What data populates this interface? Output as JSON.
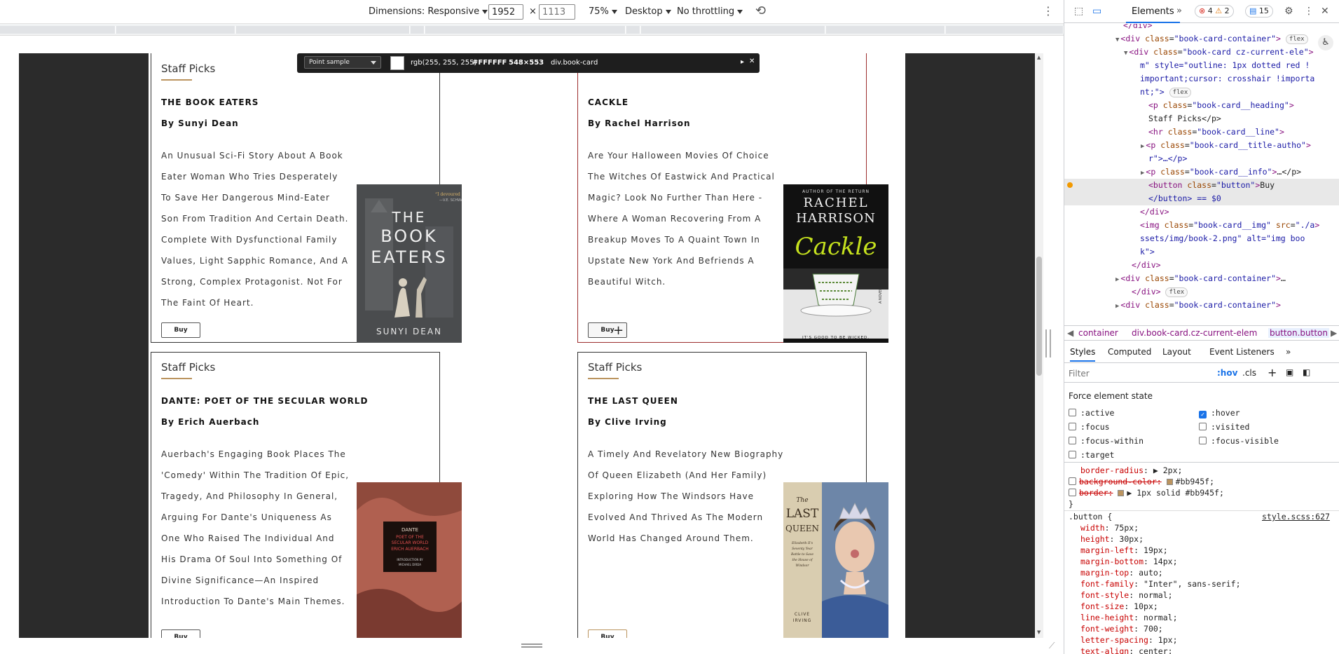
{
  "toolbar": {
    "dimensions_label": "Dimensions: Responsive",
    "width": "1952",
    "height_placeholder": "1113",
    "times": "×",
    "zoom": "75%",
    "device": "Desktop",
    "throttling": "No throttling"
  },
  "picker": {
    "mode": "Point sample",
    "rgb": "rgb(255, 255, 255)",
    "hex": "#FFFFFF",
    "size": "548×553",
    "target": "div.book-card"
  },
  "cards": [
    {
      "heading": "Staff Picks",
      "title": "THE BOOK EATERS",
      "author": "By Sunyi Dean",
      "info": "An Unusual Sci-Fi Story About A Book Eater Woman Who Tries Desperately To Save Her Dangerous Mind-Eater Son From Tradition And Certain Death. Complete With Dysfunctional Family Values, Light Sapphic Romance, And A Strong, Complex Protagonist. Not For The Faint Of Heart.",
      "buy": "Buy",
      "cover": {
        "line1": "THE",
        "line2": "BOOK",
        "line3": "EATERS",
        "author": "SUNYI DEAN",
        "quote": "\"I devoured this\" —V.E. SCHWAB",
        "bg": "#4a4c4e"
      }
    },
    {
      "heading": "Staff Picks",
      "title": "CACKLE",
      "author": "By Rachel Harrison",
      "info": "Are Your Halloween Movies Of Choice The Witches Of Eastwick And Practical Magic? Look No Further Than Here - Where A Woman Recovering From A Breakup Moves To A Quaint Town In Upstate New York And Befriends A Beautiful Witch.",
      "buy": "Buy",
      "cover": {
        "top": "AUTHOR OF THE RETURN",
        "line1": "RACHEL",
        "line2": "HARRISON",
        "title": "Cackle",
        "side": "A NOVEL",
        "bottom": "IT'S GOOD TO BE WICKED.",
        "bg": "#111111"
      }
    },
    {
      "heading": "Staff Picks",
      "title": "DANTE: POET OF THE SECULAR WORLD",
      "author": "By Erich Auerbach",
      "info": "Auerbach's Engaging Book Places The 'Comedy' Within The Tradition Of Epic, Tragedy, And Philosophy In General, Arguing For Dante's Uniqueness As One Who Raised The Individual And His Drama Of Soul Into Something Of Divine Significance—An Inspired Introduction To Dante's Main Themes.",
      "buy": "Buy",
      "cover": {
        "line1": "DANTE",
        "line2": "POET OF THE",
        "line3": "SECULAR WORLD",
        "author": "ERICH AUERBACH",
        "intro": "INTRODUCTION BY",
        "intro_name": "MICHAEL DIRDA",
        "bg": "#b06050"
      }
    },
    {
      "heading": "Staff Picks",
      "title": "THE LAST QUEEN",
      "author": "By Clive Irving",
      "info": "A Timely And Revelatory New Biography Of Queen Elizabeth (And Her Family) Exploring How The Windsors Have Evolved And Thrived As The Modern World Has Changed Around Them.",
      "buy": "Buy",
      "cover": {
        "line1": "The",
        "line2": "LAST",
        "line3": "QUEEN",
        "sub": "Elizabeth II's Seventy Year Battle to Save the House of Windsor",
        "author": "CLIVE IRVING",
        "bg": "#d9cdb0"
      }
    }
  ],
  "devtools": {
    "tab_elements": "Elements",
    "errors": "4",
    "warnings": "2",
    "messages": "15",
    "dom": [
      {
        "indent": 6,
        "html": "</div>"
      },
      {
        "indent": 6,
        "tri": "▼",
        "tag": "div",
        "attrs": [
          [
            "class",
            "book-card-container"
          ]
        ],
        "tail": "",
        "chip": "flex"
      },
      {
        "indent": 7,
        "tri": "▼",
        "tag": "div",
        "attrs": [
          [
            "class",
            "book-card cz-current-ele"
          ]
        ]
      },
      {
        "indent": 8,
        "plain": "m\" style=\"outline: 1px dotted red !"
      },
      {
        "indent": 8,
        "plain": "important;cursor: crosshair !importa"
      },
      {
        "indent": 8,
        "plain": "nt;\">",
        "chip": "flex"
      },
      {
        "indent": 9,
        "tag": "p",
        "attrs": [
          [
            "class",
            "book-card__heading"
          ]
        ]
      },
      {
        "indent": 9,
        "text": "Staff Picks</p>"
      },
      {
        "indent": 9,
        "tag": "hr",
        "attrs": [
          [
            "class",
            "book-card__line"
          ]
        ]
      },
      {
        "indent": 9,
        "tri": "▶",
        "tag": "p",
        "attrs": [
          [
            "class",
            "book-card__title-autho"
          ]
        ]
      },
      {
        "indent": 9,
        "plain": "r\">…</p>"
      },
      {
        "indent": 9,
        "tri": "▶",
        "tag": "p",
        "attrs": [
          [
            "class",
            "book-card__info"
          ]
        ],
        "tail": "…</p>"
      },
      {
        "indent": 9,
        "tag": "button",
        "attrs": [
          [
            "class",
            "button"
          ]
        ],
        "tail": "Buy",
        "selected": true
      },
      {
        "indent": 9,
        "plain": "</button> == $0",
        "selected": true
      },
      {
        "indent": 8,
        "html": "</div>"
      },
      {
        "indent": 8,
        "tag": "img",
        "attrs": [
          [
            "class",
            "book-card__img"
          ],
          [
            "src",
            "./a"
          ]
        ]
      },
      {
        "indent": 8,
        "plain": "ssets/img/book-2.png\" alt=\"img boo"
      },
      {
        "indent": 8,
        "plain": "k\">"
      },
      {
        "indent": 7,
        "html": "</div>"
      },
      {
        "indent": 6,
        "tri": "▶",
        "tag": "div",
        "attrs": [
          [
            "class",
            "book-card-container"
          ]
        ],
        "tail": "…"
      },
      {
        "indent": 7,
        "html": "</div>",
        "chip": "flex"
      },
      {
        "indent": 6,
        "tri": "▶",
        "tag": "div",
        "attrs": [
          [
            "class",
            "book-card-container"
          ]
        ]
      }
    ],
    "crumbs": [
      "container",
      "div.book-card.cz-current-elem",
      "button.button"
    ],
    "subtabs": [
      "Styles",
      "Computed",
      "Layout",
      "Event Listeners"
    ],
    "filter_placeholder": "Filter",
    "hov": ":hov",
    "cls": ".cls",
    "force_title": "Force element state",
    "states_left": [
      ":active",
      ":focus",
      ":focus-within",
      ":target"
    ],
    "states_right": [
      ":hover",
      ":visited",
      ":focus-visible"
    ],
    "style_rules": [
      {
        "prop": "border-radius",
        "val": "▶ 2px;",
        "strike": false
      },
      {
        "prop": "background-color",
        "val": "#bb945f;",
        "strike": true,
        "swatch": true
      },
      {
        "prop": "border",
        "val": "▶ 1px solid  #bb945f;",
        "strike": true,
        "swatch": true
      }
    ],
    "button_selector": ".button {",
    "button_source": "style.scss:627",
    "button_rules": [
      [
        "width",
        "75px;"
      ],
      [
        "height",
        "30px;"
      ],
      [
        "margin-left",
        "19px;"
      ],
      [
        "margin-bottom",
        "14px;"
      ],
      [
        "margin-top",
        "auto;"
      ],
      [
        "font-family",
        "\"Inter\", sans-serif;"
      ],
      [
        "font-style",
        "normal;"
      ],
      [
        "font-size",
        "10px;"
      ],
      [
        "line-height",
        "normal;"
      ],
      [
        "font-weight",
        "700;"
      ],
      [
        "letter-spacing",
        "1px;"
      ],
      [
        "text-align",
        "center;"
      ]
    ]
  },
  "colors": {
    "accent": "#bb945f",
    "selected_outline": "#9c2d2d",
    "devtools_blue": "#1a73e8"
  }
}
